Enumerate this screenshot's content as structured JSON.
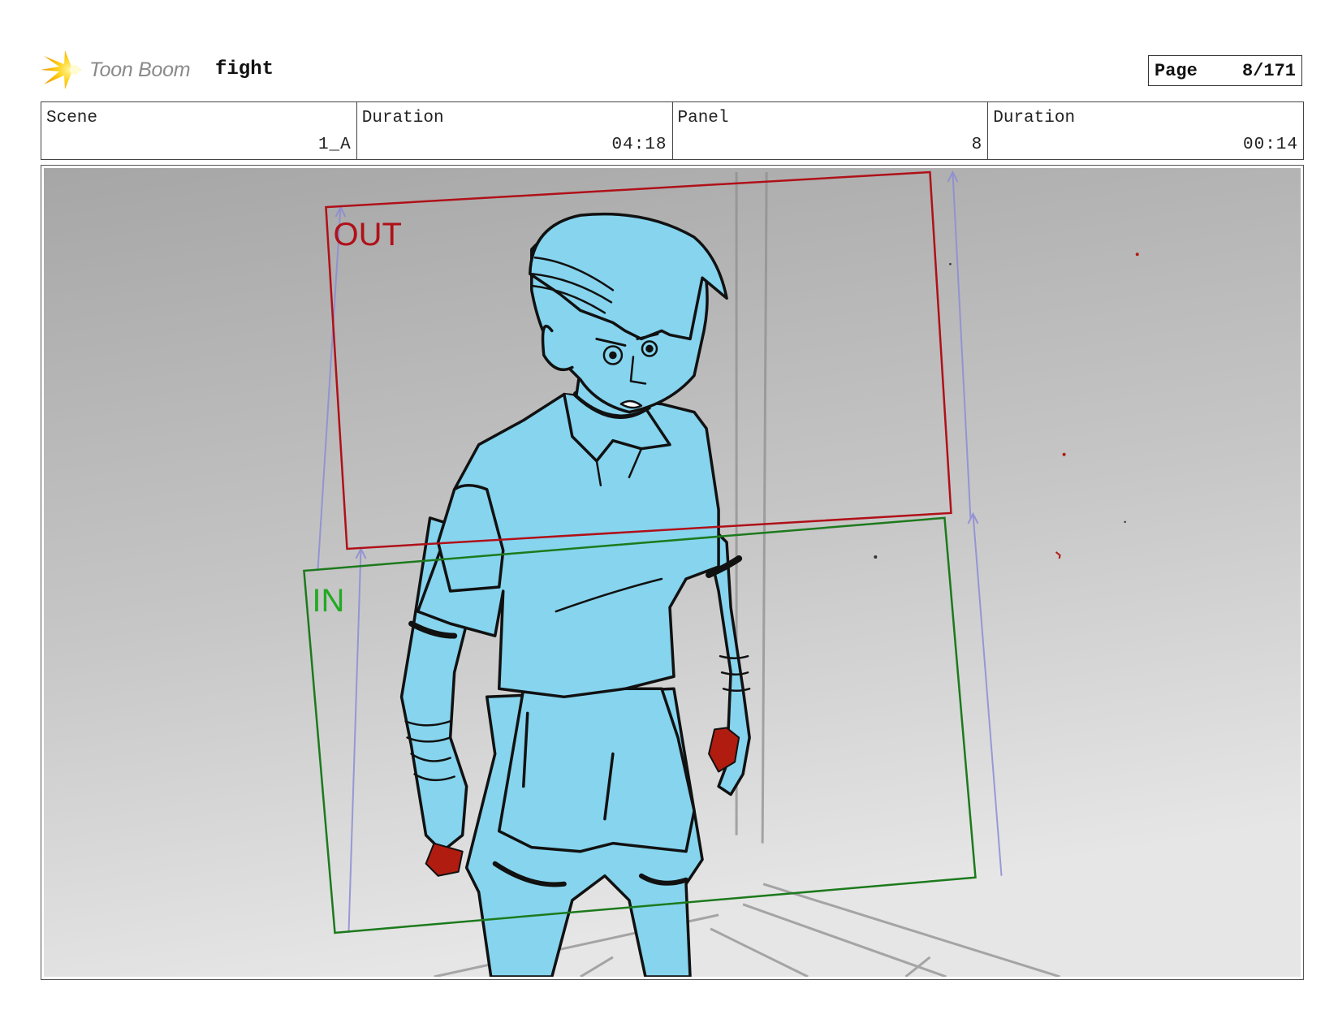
{
  "header": {
    "logo_text": "Toon Boom",
    "project_title": "fight",
    "page_label": "Page",
    "page_value": "8/171"
  },
  "info": [
    {
      "label": "Scene",
      "value": "1_A"
    },
    {
      "label": "Duration",
      "value": "04:18"
    },
    {
      "label": "Panel",
      "value": "8"
    },
    {
      "label": "Duration",
      "value": "00:14"
    }
  ],
  "panel": {
    "out_label": "OUT",
    "in_label": "IN",
    "colors": {
      "out_frame": "#b01018",
      "in_frame": "#1c7a1c",
      "in_text": "#22aa22",
      "camera_guides": "#8c8cd6",
      "character_fill": "#86d4ee",
      "blood": "#b01c10"
    }
  }
}
